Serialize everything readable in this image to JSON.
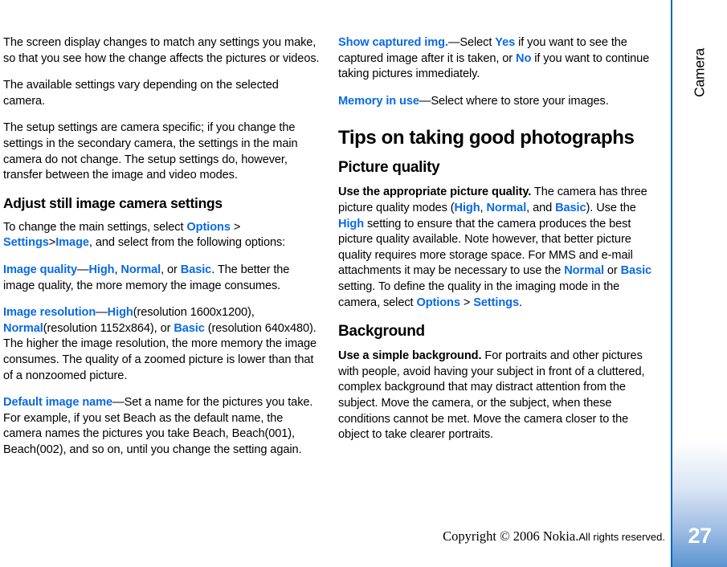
{
  "chapter_tab": {
    "label": "Camera"
  },
  "page_number": "27",
  "footer": {
    "copyright": "Copyright © 2006 Nokia.",
    "rights": "All rights reserved."
  },
  "colors": {
    "highlight_blue": "#0a6ae4",
    "rule_blue": "#0069b4",
    "tab_gradient_bottom": "#5a94d0"
  },
  "left_column": {
    "paragraphs": {
      "p1": "The screen display changes to match any settings you make, so that you see how the change affects the pictures or videos.",
      "p2": "The available settings vary depending on the selected camera.",
      "p3": "The setup settings are camera specific; if you change the settings in the secondary camera, the settings in the main camera do not change. The setup settings do, however, transfer between the image and video modes."
    },
    "heading_adjust": "Adjust still image camera settings",
    "intro": {
      "t1": "To change the main settings, select ",
      "options": "Options",
      "t2": " > ",
      "settings": "Settings",
      "t3": ">",
      "image": "Image",
      "t4": ", and select from the following options:"
    },
    "image_quality": {
      "term": "Image quality",
      "t1": "—",
      "high": "High",
      "t2": ", ",
      "normal": "Normal",
      "t3": ", or ",
      "basic": "Basic",
      "t4": ". The better the image quality, the more memory the image consumes."
    },
    "image_resolution": {
      "term": "Image resolution",
      "t1": "—",
      "high": "High",
      "t2": "(resolution 1600x1200), ",
      "normal": "Normal",
      "t3": "(resolution 1152x864), or ",
      "basic": "Basic",
      "t4": " (resolution 640x480). The higher the image resolution, the more memory the image consumes. The quality of a zoomed picture is lower than that of a nonzoomed picture."
    },
    "default_image_name": {
      "term": "Default image name",
      "t1": "—Set a name for the pictures you take. For example, if you set Beach as the default name, the camera names the pictures you take Beach, Beach(001), Beach(002), and so on, until you change the setting again."
    }
  },
  "right_column": {
    "show_captured": {
      "term": "Show captured img.",
      "t1": "—Select ",
      "yes": "Yes",
      "t2": " if you want to see the captured image after it is taken, or ",
      "no": "No",
      "t3": " if you want to continue taking pictures immediately."
    },
    "memory_in_use": {
      "term": "Memory in use",
      "t1": "—Select where to store your images."
    },
    "heading_tips": "Tips on taking good photographs",
    "heading_picture_quality": "Picture quality",
    "picture_quality": {
      "lead": "Use the appropriate picture quality.",
      "t1": " The camera has three picture quality modes (",
      "high1": "High",
      "t2": ", ",
      "normal1": "Normal",
      "t3": ", and ",
      "basic1": "Basic",
      "t4": "). Use the ",
      "high2": "High",
      "t5": " setting to ensure that the camera produces the best picture quality available. Note however, that better picture quality requires more storage space. For MMS and e-mail attachments it may be necessary to use the ",
      "normal2": "Normal",
      "t6": " or ",
      "basic2": "Basic",
      "t7": " setting. To define the quality in the imaging mode in the camera, select ",
      "options": "Options",
      "t8": " > ",
      "settings": "Settings",
      "t9": "."
    },
    "heading_background": "Background",
    "background": {
      "lead": "Use a simple background.",
      "t1": " For portraits and other pictures with people, avoid having your subject in front of a cluttered, complex background that may distract attention from the subject. Move the camera, or the subject, when these conditions cannot be met. Move the camera closer to the object to take clearer portraits."
    }
  }
}
